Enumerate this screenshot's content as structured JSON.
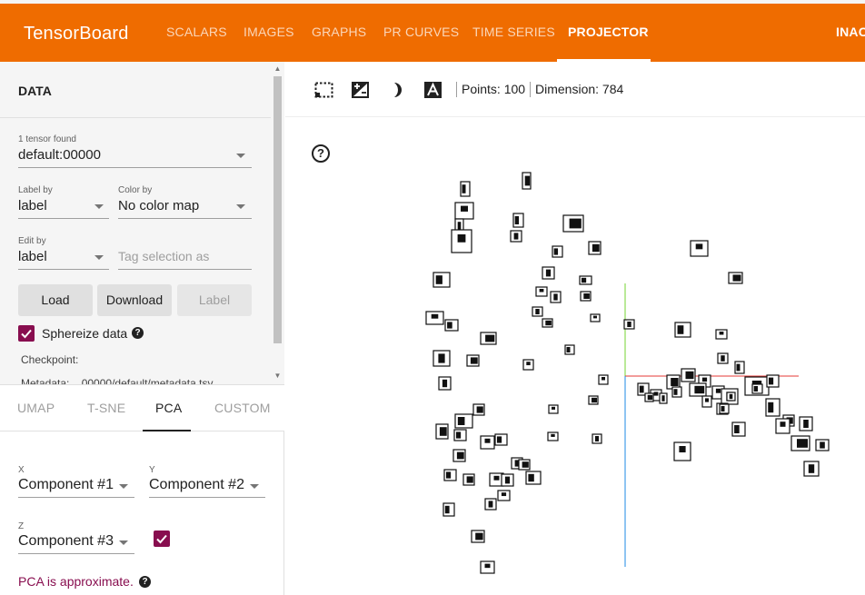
{
  "header": {
    "brand": "TensorBoard",
    "tabs": [
      "SCALARS",
      "IMAGES",
      "GRAPHS",
      "PR CURVES",
      "TIME SERIES",
      "PROJECTOR",
      "INAC"
    ],
    "active_tab": "PROJECTOR",
    "color": "#ef6c00"
  },
  "data_panel": {
    "title": "DATA",
    "tensor_found": "1 tensor found",
    "tensor_value": "default:00000",
    "label_by_label": "Label by",
    "label_by_value": "label",
    "color_by_label": "Color by",
    "color_by_value": "No color map",
    "edit_by_label": "Edit by",
    "edit_by_value": "label",
    "tag_placeholder": "Tag selection as",
    "load_button": "Load",
    "download_button": "Download",
    "label_button": "Label",
    "sphereize_label": "Sphereize data",
    "sphereize_checked": true,
    "checkpoint": "Checkpoint:",
    "metadata": "Metadata:    00000/default/metadata.tsv"
  },
  "method_tabs": {
    "items": [
      "UMAP",
      "T-SNE",
      "PCA",
      "CUSTOM"
    ],
    "active": "PCA"
  },
  "pca": {
    "x_label": "X",
    "x_value": "Component #1",
    "y_label": "Y",
    "y_value": "Component #2",
    "z_label": "Z",
    "z_value": "Component #3",
    "z_checked": true,
    "note": "PCA is approximate."
  },
  "toolbar": {
    "points": "Points: 100",
    "dimension": "Dimension: 784",
    "icons": [
      "select-rectangle-icon",
      "edit-label-icon",
      "night-mode-icon",
      "label-text-icon"
    ]
  },
  "accent_color": "#880e4f",
  "axis_colors": {
    "x": "#e53935",
    "y": "#76d330",
    "z": "#1e88e5"
  }
}
